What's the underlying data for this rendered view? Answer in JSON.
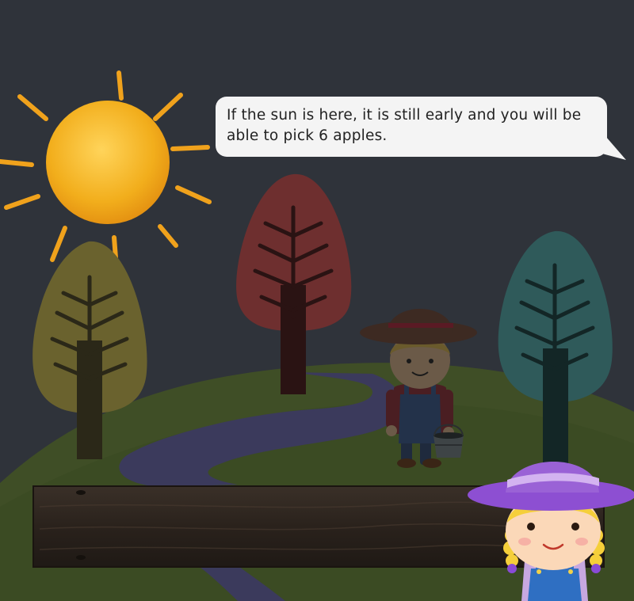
{
  "dialog": {
    "text": "If the sun is here, it is still early and you will be able to pick 6 apples."
  },
  "colors": {
    "sky": "#2f333a",
    "hill": "#3f4e26",
    "river": "#3b3a5c",
    "sun": "#f2b21e",
    "tree_olive": "#6a622e",
    "tree_red": "#6e2f2f",
    "tree_teal": "#2f5a5a",
    "plank": "#2e2620",
    "hat": "#9a62d6"
  },
  "icons": {
    "sun": "sun-icon",
    "farmer_boy": "farmer-boy-icon",
    "farmer_girl": "farmer-girl-icon",
    "bucket": "bucket-icon"
  }
}
